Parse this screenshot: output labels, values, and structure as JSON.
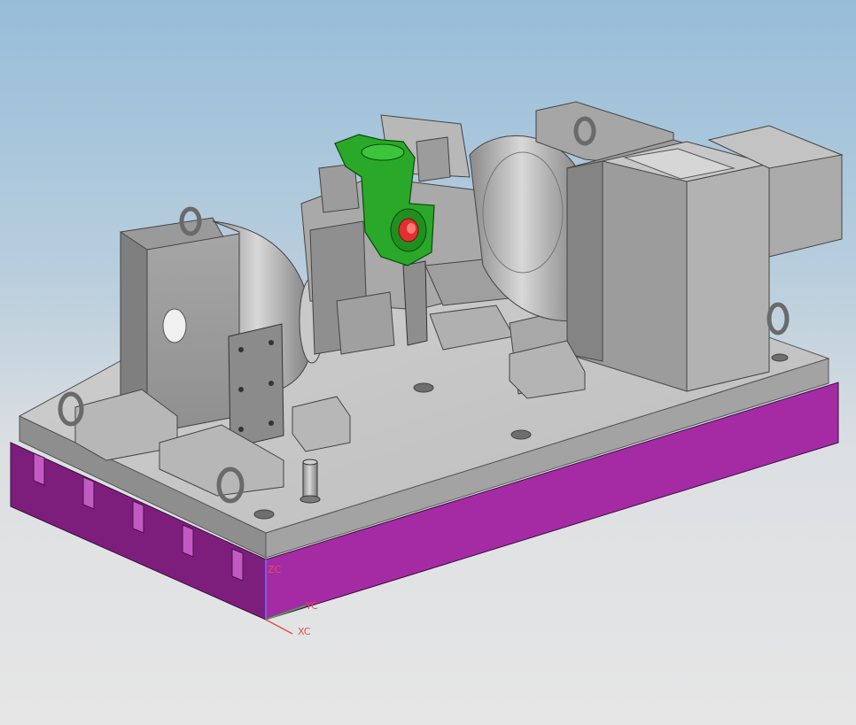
{
  "viewport": {
    "background_top": "#97bdd9",
    "background_bottom": "#e6e6e6"
  },
  "colors": {
    "base_block": "#a52ba5",
    "fixture_plate": "#c8c8c8",
    "steel": "#b4b4b4",
    "workpiece": "#2aa82a",
    "workpiece_bore": "#e03030",
    "axis_x": "#e05050",
    "axis_y": "#40b040",
    "axis_z": "#e05050"
  },
  "triad": {
    "zc_label": "ZC",
    "yc_label": "YC",
    "xc_label": "XC"
  }
}
